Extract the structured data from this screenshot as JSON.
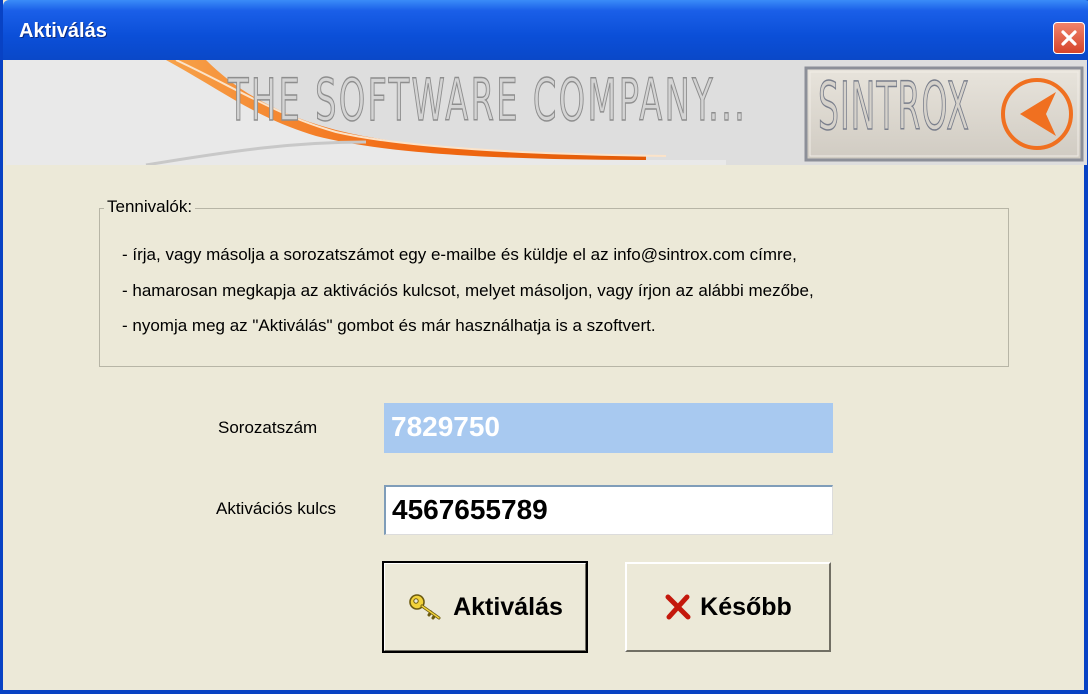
{
  "window": {
    "title": "Aktiválás"
  },
  "banner": {
    "slogan": "THE SOFTWARE COMPANY...",
    "logo_text": "SINTROX"
  },
  "instructions": {
    "title": "Tennivalók:",
    "lines": [
      "- írja, vagy másolja a sorozatszámot egy e-mailbe és küldje el az  info@sintrox.com  címre,",
      "- hamarosan megkapja az aktivációs kulcsot, melyet másoljon, vagy írjon az alábbi mezőbe,",
      "- nyomja meg az \"Aktiválás\" gombot és már használhatja is a szoftvert."
    ]
  },
  "form": {
    "serial_label": "Sorozatszám",
    "serial_value": "7829750",
    "key_label": "Aktivációs kulcs",
    "key_value": "4567655789"
  },
  "buttons": {
    "activate_label": "Aktiválás",
    "later_label": "Később"
  },
  "colors": {
    "titlebar": "#0b4fd8",
    "dialog_bg": "#ece9d8",
    "accent_orange": "#f07020",
    "serial_highlight": "#a8c9f0"
  },
  "icons": [
    "close-icon",
    "key-icon",
    "x-mark-icon",
    "sintrox-arrow-icon"
  ]
}
